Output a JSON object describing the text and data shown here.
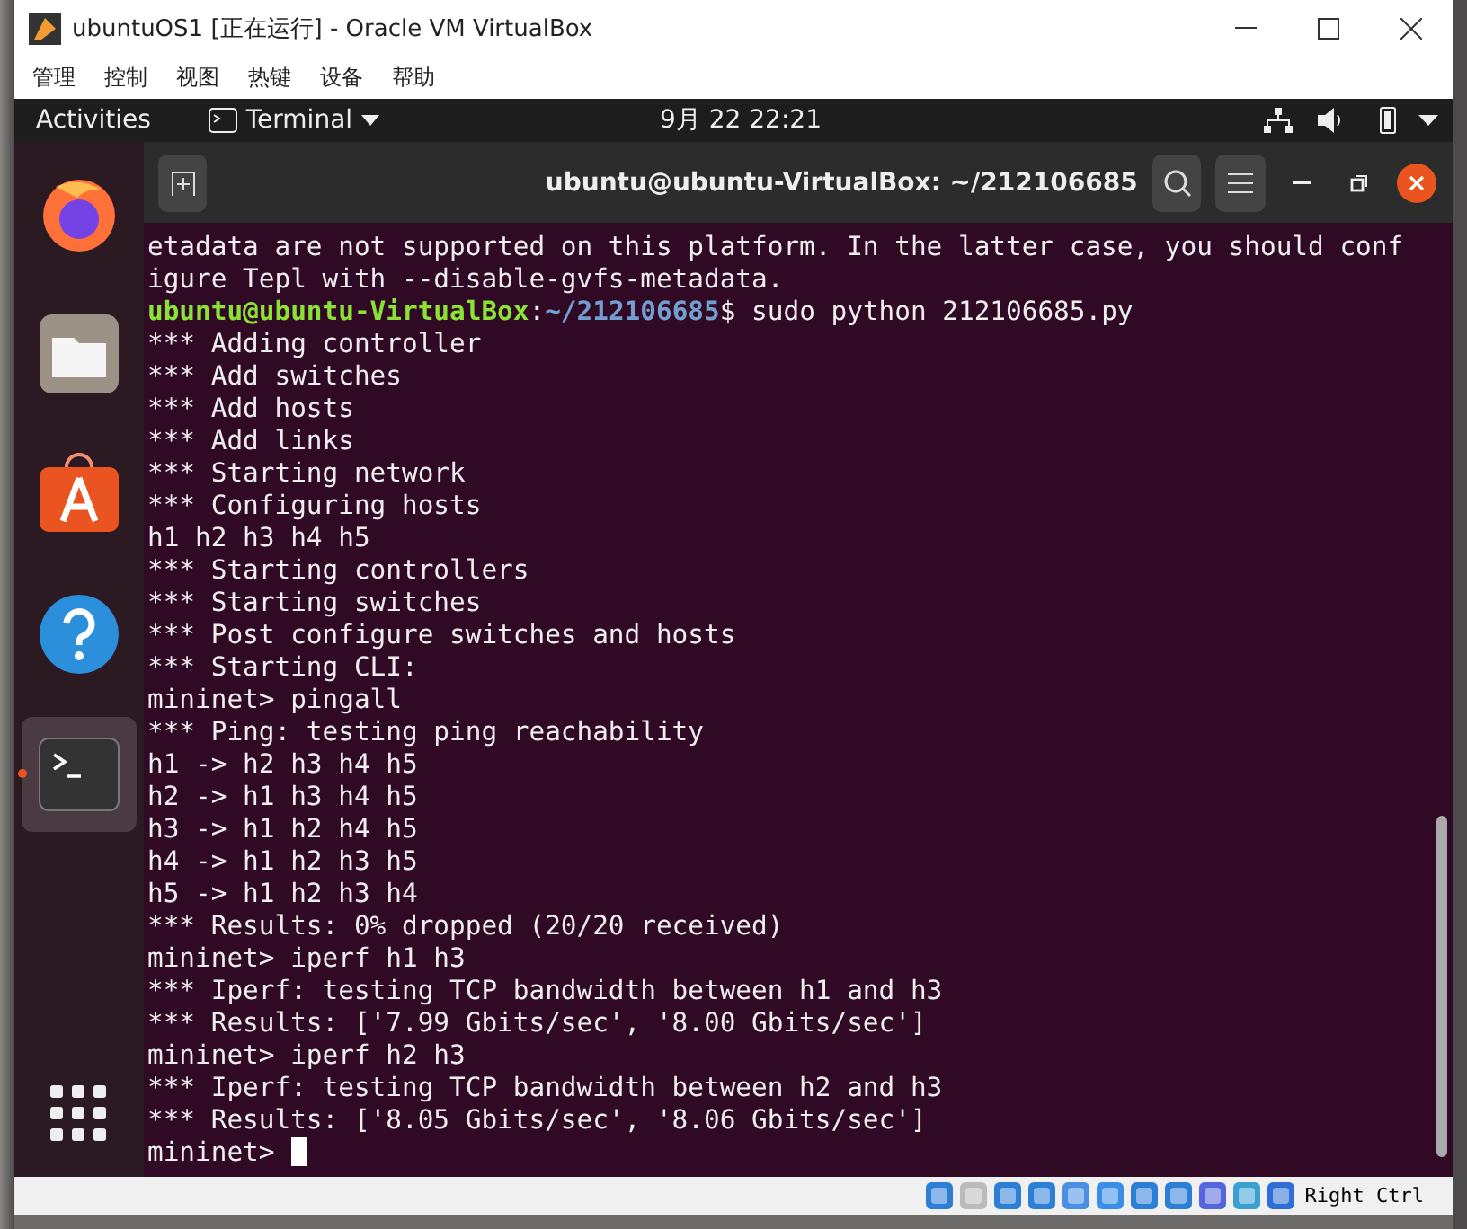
{
  "window": {
    "title": "ubuntuOS1 [正在运行] - Oracle VM VirtualBox"
  },
  "menu": [
    "管理",
    "控制",
    "视图",
    "热键",
    "设备",
    "帮助"
  ],
  "top_bar": {
    "activities": "Activities",
    "app": "Terminal",
    "clock": "9月 22  22:21"
  },
  "dock": [
    {
      "kind": "firefox",
      "selected": false
    },
    {
      "kind": "files",
      "selected": false
    },
    {
      "kind": "software",
      "selected": false
    },
    {
      "kind": "help",
      "selected": false
    },
    {
      "kind": "terminal",
      "selected": true
    }
  ],
  "terminal": {
    "title": "ubuntu@ubuntu-VirtualBox: ~/212106685",
    "cursor": true,
    "lines": [
      {
        "kind": "output",
        "text": "etadata are not supported on this platform. In the latter case, you should conf"
      },
      {
        "kind": "output",
        "text": "igure Tepl with --disable-gvfs-metadata."
      },
      {
        "kind": "prompt",
        "user": "ubuntu@ubuntu-VirtualBox",
        "separator": ":",
        "path": "~/212106685",
        "symbol": "$",
        "command": "sudo python 212106685.py"
      },
      {
        "kind": "output",
        "text": "*** Adding controller"
      },
      {
        "kind": "output",
        "text": "*** Add switches"
      },
      {
        "kind": "output",
        "text": "*** Add hosts"
      },
      {
        "kind": "output",
        "text": "*** Add links"
      },
      {
        "kind": "output",
        "text": "*** Starting network"
      },
      {
        "kind": "output",
        "text": "*** Configuring hosts"
      },
      {
        "kind": "output",
        "text": "h1 h2 h3 h4 h5"
      },
      {
        "kind": "output",
        "text": "*** Starting controllers"
      },
      {
        "kind": "output",
        "text": "*** Starting switches"
      },
      {
        "kind": "output",
        "text": "*** Post configure switches and hosts"
      },
      {
        "kind": "output",
        "text": "*** Starting CLI:"
      },
      {
        "kind": "output",
        "text": "mininet> pingall"
      },
      {
        "kind": "output",
        "text": "*** Ping: testing ping reachability"
      },
      {
        "kind": "output",
        "text": "h1 -> h2 h3 h4 h5"
      },
      {
        "kind": "output",
        "text": "h2 -> h1 h3 h4 h5"
      },
      {
        "kind": "output",
        "text": "h3 -> h1 h2 h4 h5"
      },
      {
        "kind": "output",
        "text": "h4 -> h1 h2 h3 h5"
      },
      {
        "kind": "output",
        "text": "h5 -> h1 h2 h3 h4"
      },
      {
        "kind": "output",
        "text": "*** Results: 0% dropped (20/20 received)"
      },
      {
        "kind": "output",
        "text": "mininet> iperf h1 h3"
      },
      {
        "kind": "output",
        "text": "*** Iperf: testing TCP bandwidth between h1 and h3"
      },
      {
        "kind": "output",
        "text": "*** Results: ['7.99 Gbits/sec', '8.00 Gbits/sec']"
      },
      {
        "kind": "output",
        "text": "mininet> iperf h2 h3"
      },
      {
        "kind": "output",
        "text": "*** Iperf: testing TCP bandwidth between h2 and h3"
      },
      {
        "kind": "output",
        "text": "*** Results: ['8.05 Gbits/sec', '8.06 Gbits/sec']"
      },
      {
        "kind": "output",
        "text": "mininet> "
      }
    ]
  },
  "status_bar": {
    "host_key": "Right Ctrl"
  }
}
